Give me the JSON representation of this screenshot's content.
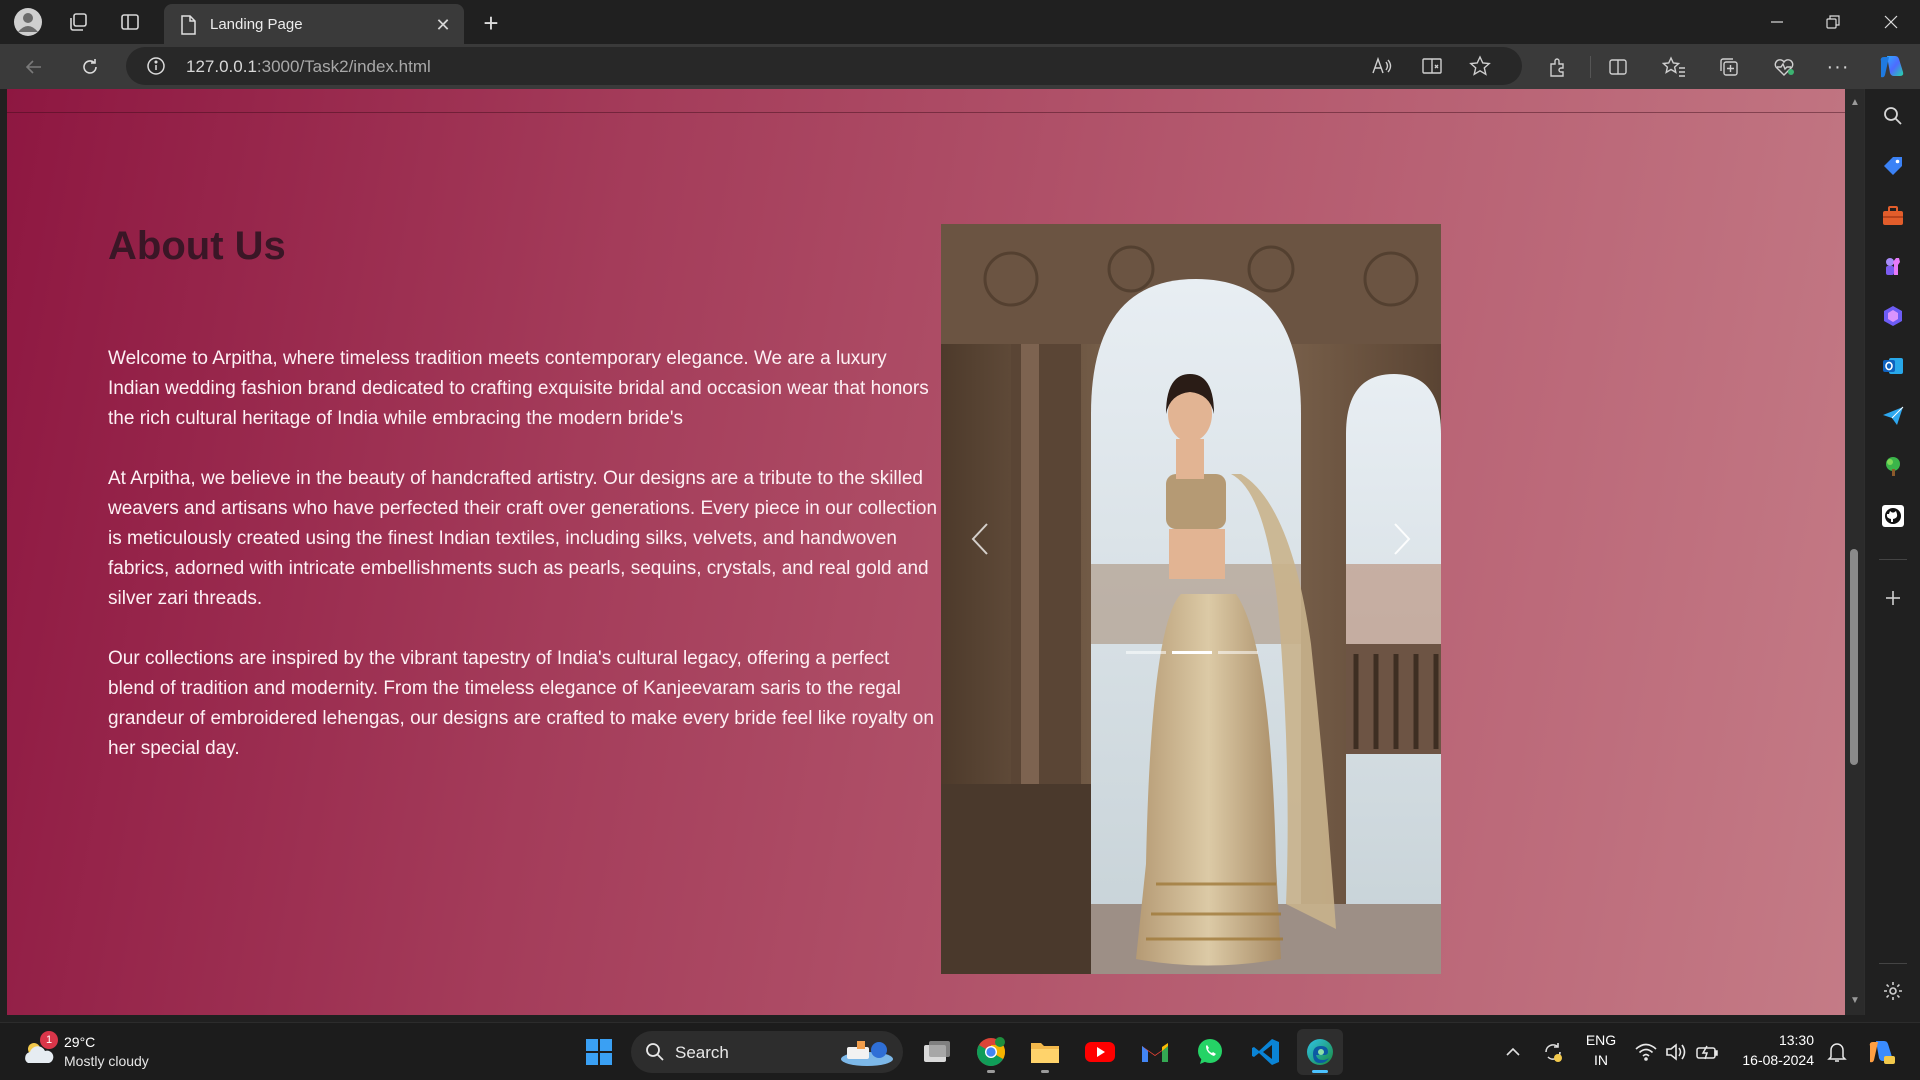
{
  "browser": {
    "tab_title": "Landing Page",
    "url_host": "127.0.0.1",
    "url_path": ":3000/Task2/index.html"
  },
  "page": {
    "heading": "About Us",
    "paragraphs": [
      "Welcome to Arpitha, where timeless tradition meets contemporary elegance. We are a luxury Indian wedding fashion brand dedicated to crafting exquisite bridal and occasion wear that honors the rich cultural heritage of India while embracing the modern bride's",
      "At Arpitha, we believe in the beauty of handcrafted artistry. Our designs are a tribute to the skilled weavers and artisans who have perfected their craft over generations. Every piece in our collection is meticulously created using the finest Indian textiles, including silks, velvets, and handwoven fabrics, adorned with intricate embellishments such as pearls, sequins, crystals, and real gold and silver zari threads.",
      "Our collections are inspired by the vibrant tapestry of India's cultural legacy, offering a perfect blend of tradition and modernity. From the timeless elegance of Kanjeevaram saris to the regal grandeur of embroidered lehengas, our designs are crafted to make every bride feel like royalty on her special day."
    ],
    "carousel_slides": 3,
    "carousel_active": 2
  },
  "taskbar": {
    "weather_temp": "29°C",
    "weather_cond": "Mostly cloudy",
    "weather_badge": "1",
    "search_label": "Search",
    "lang_top": "ENG",
    "lang_bottom": "IN",
    "time": "13:30",
    "date": "16-08-2024"
  },
  "colors": {
    "page_gradient_start": "#8e1741",
    "page_gradient_end": "#c47b86",
    "heading": "#3a1626",
    "body_text": "#fdf0f4"
  }
}
